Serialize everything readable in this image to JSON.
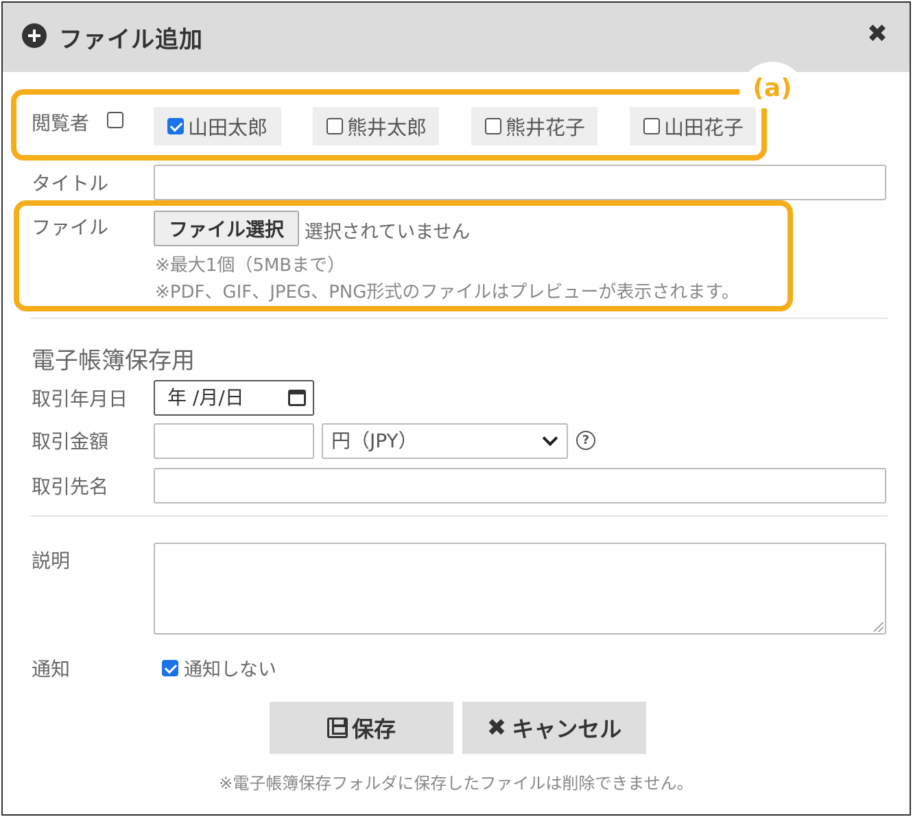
{
  "dialog": {
    "title": "ファイル追加",
    "close_icon": "close-icon",
    "title_icon": "plus-circle-icon"
  },
  "annotation": {
    "badge": "(a)",
    "color": "#f5ad1a"
  },
  "viewers": {
    "label": "閲覧者",
    "all_checked": false,
    "items": [
      {
        "name": "山田太郎",
        "checked": true
      },
      {
        "name": "熊井太郎",
        "checked": false
      },
      {
        "name": "熊井花子",
        "checked": false
      },
      {
        "name": "山田花子",
        "checked": false
      }
    ]
  },
  "title_field": {
    "label": "タイトル",
    "value": ""
  },
  "file_field": {
    "label": "ファイル",
    "button_label": "ファイル選択",
    "status": "選択されていません",
    "note1": "※最大1個（5MBまで）",
    "note2": "※PDF、GIF、JPEG、PNG形式のファイルはプレビューが表示されます。"
  },
  "ebook": {
    "section_title": "電子帳簿保存用",
    "date_label": "取引年月日",
    "date_value": "年 /月/日",
    "amount_label": "取引金額",
    "amount_value": "",
    "currency_value": "円（JPY）",
    "client_label": "取引先名",
    "client_value": ""
  },
  "description": {
    "label": "説明",
    "value": ""
  },
  "notify": {
    "label": "通知",
    "option_label": "通知しない",
    "checked": true
  },
  "actions": {
    "save_label": "保存",
    "cancel_label": "キャンセル"
  },
  "footer_note": "※電子帳簿保存フォルダに保存したファイルは削除できません。",
  "colors": {
    "header_bg": "#dcdcdc",
    "checkbox_checked": "#1a73e8",
    "highlight": "#f5ad1a"
  }
}
